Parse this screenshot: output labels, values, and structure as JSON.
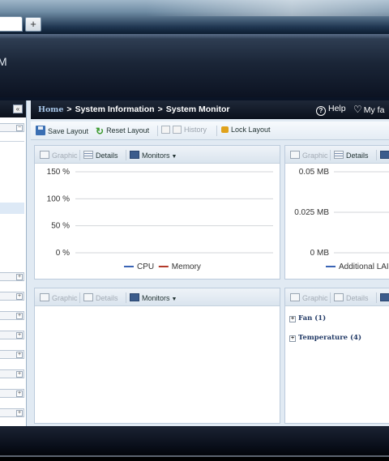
{
  "browser": {
    "new_tab_label": "+"
  },
  "app": {
    "logo_fragment": "M"
  },
  "sidebar": {
    "collapse_label": "«",
    "expand_label": "−",
    "plus_label": "+"
  },
  "breadcrumb": {
    "home": "Home",
    "separator": ">",
    "system_information": "System Information",
    "current": "System Monitor"
  },
  "header_links": {
    "help": "Help",
    "favorites": "My fa"
  },
  "toolbar": {
    "save_layout": "Save Layout",
    "reset_layout": "Reset Layout",
    "history": "History",
    "lock_layout": "Lock Layout"
  },
  "widget_controls": {
    "graphic": "Graphic",
    "details": "Details",
    "monitors": "Monitors"
  },
  "tree": {
    "fan": "Fan (1)",
    "temperature": "Temperature (4)"
  },
  "chart_data": [
    {
      "type": "line",
      "y_ticks": [
        "150 %",
        "100 %",
        "50 %",
        "0 %"
      ],
      "ylim": [
        0,
        150
      ],
      "grid": true,
      "legend_position": "bottom",
      "series": [
        {
          "name": "CPU",
          "color": "#3a64b5",
          "values": []
        },
        {
          "name": "Memory",
          "color": "#b33a2a",
          "values": []
        }
      ]
    },
    {
      "type": "line",
      "y_ticks": [
        "0.05 MB",
        "0.025 MB",
        "0 MB"
      ],
      "ylim": [
        0,
        0.05
      ],
      "grid": true,
      "legend_position": "bottom",
      "series": [
        {
          "name": "Additional LAI",
          "color": "#3a64b5",
          "values": []
        }
      ]
    }
  ]
}
